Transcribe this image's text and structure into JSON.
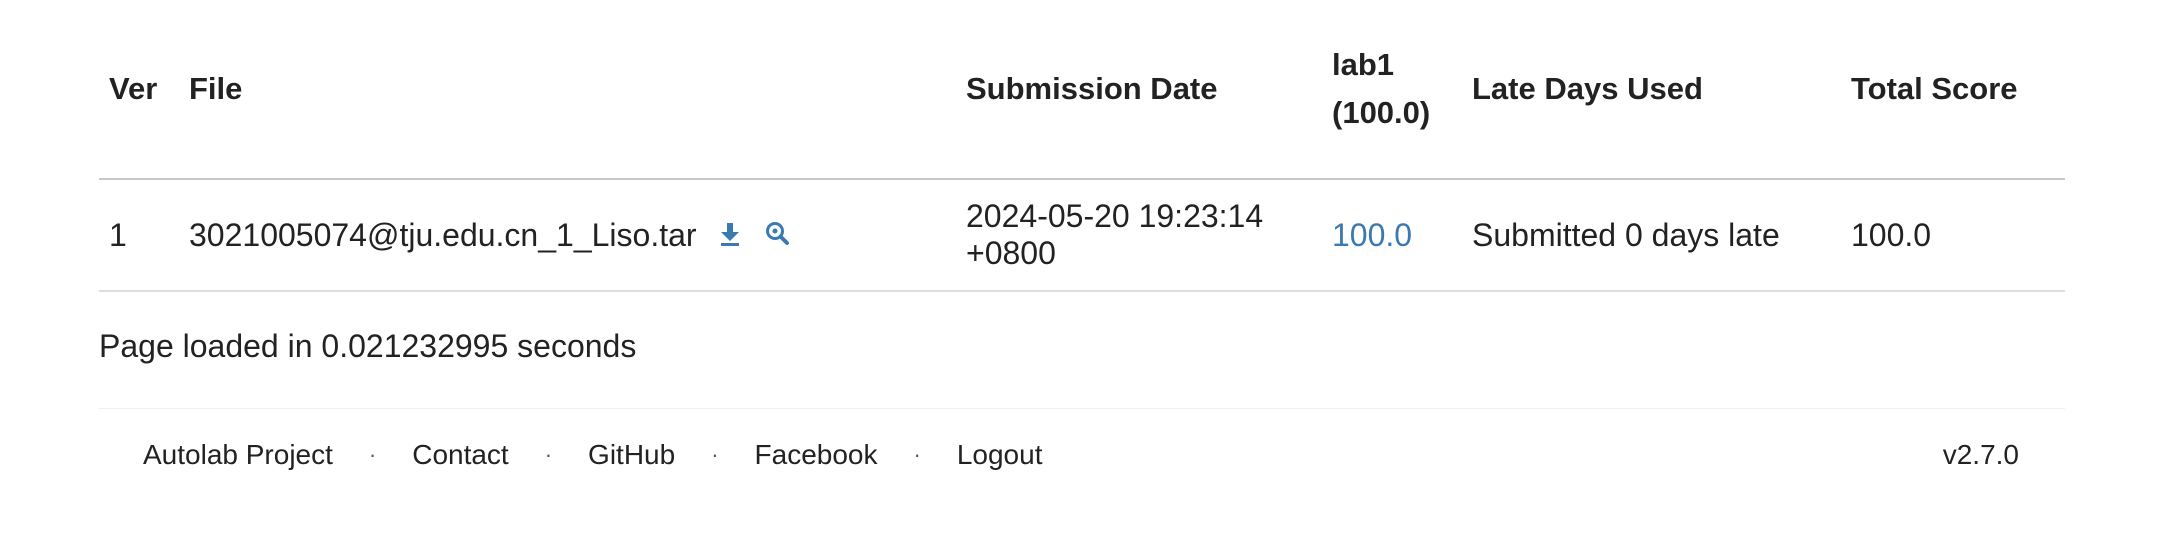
{
  "table": {
    "headers": {
      "ver": "Ver",
      "file": "File",
      "submission_date": "Submission Date",
      "lab_line1": "lab1",
      "lab_line2": "(100.0)",
      "late_days": "Late Days Used",
      "total_score": "Total Score"
    },
    "rows": [
      {
        "ver": "1",
        "file": "3021005074@tju.edu.cn_1_Liso.tar",
        "download_icon": "download-icon",
        "view_icon": "magnifier-icon",
        "submission_date": "2024-05-20 19:23:14 +0800",
        "lab_score": "100.0",
        "late_days": "Submitted 0 days late",
        "total_score": "100.0"
      }
    ]
  },
  "status": {
    "load_time": "Page loaded in 0.021232995 seconds"
  },
  "footer": {
    "links": [
      "Autolab Project",
      "Contact",
      "GitHub",
      "Facebook",
      "Logout"
    ],
    "separator": "·",
    "version": "v2.7.0"
  },
  "colors": {
    "link": "#3b7ab0",
    "text": "#222222",
    "rule": "#c8c8c8"
  }
}
